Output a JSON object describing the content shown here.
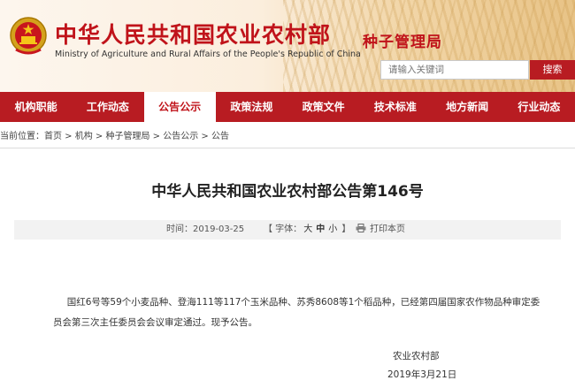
{
  "header": {
    "site_title": "中华人民共和国农业农村部",
    "site_subtitle": "Ministry of Agriculture and Rural Affairs of the People's Republic of China",
    "bureau": "种子管理局",
    "search_placeholder": "请输入关键词",
    "search_button": "搜索",
    "brand_color": "#c0131a"
  },
  "nav": {
    "items": [
      {
        "label": "机构职能"
      },
      {
        "label": "工作动态"
      },
      {
        "label": "公告公示"
      },
      {
        "label": "政策法规"
      },
      {
        "label": "政策文件"
      },
      {
        "label": "技术标准"
      },
      {
        "label": "地方新闻"
      },
      {
        "label": "行业动态"
      }
    ],
    "active": "公告公示",
    "bg_color": "#b81c22"
  },
  "breadcrumb": {
    "prefix": "当前位置：",
    "items": [
      "首页",
      "机构",
      "种子管理局",
      "公告公示",
      "公告"
    ],
    "separator": " > "
  },
  "article": {
    "title": "中华人民共和国农业农村部公告第146号",
    "time_label": "时间：",
    "time": "2019-03-25",
    "font_label": "【 字体：",
    "font_sizes": [
      "大",
      "中",
      "小"
    ],
    "font_close": " 】",
    "print_label": "打印本页",
    "body": "国红6号等59个小麦品种、登海111等117个玉米品种、苏秀8608等1个稻品种，已经第四届国家农作物品种审定委员会第三次主任委员会会议审定通过。现予公告。",
    "signature_org": "农业农村部",
    "signature_date": "2019年3月21日"
  }
}
